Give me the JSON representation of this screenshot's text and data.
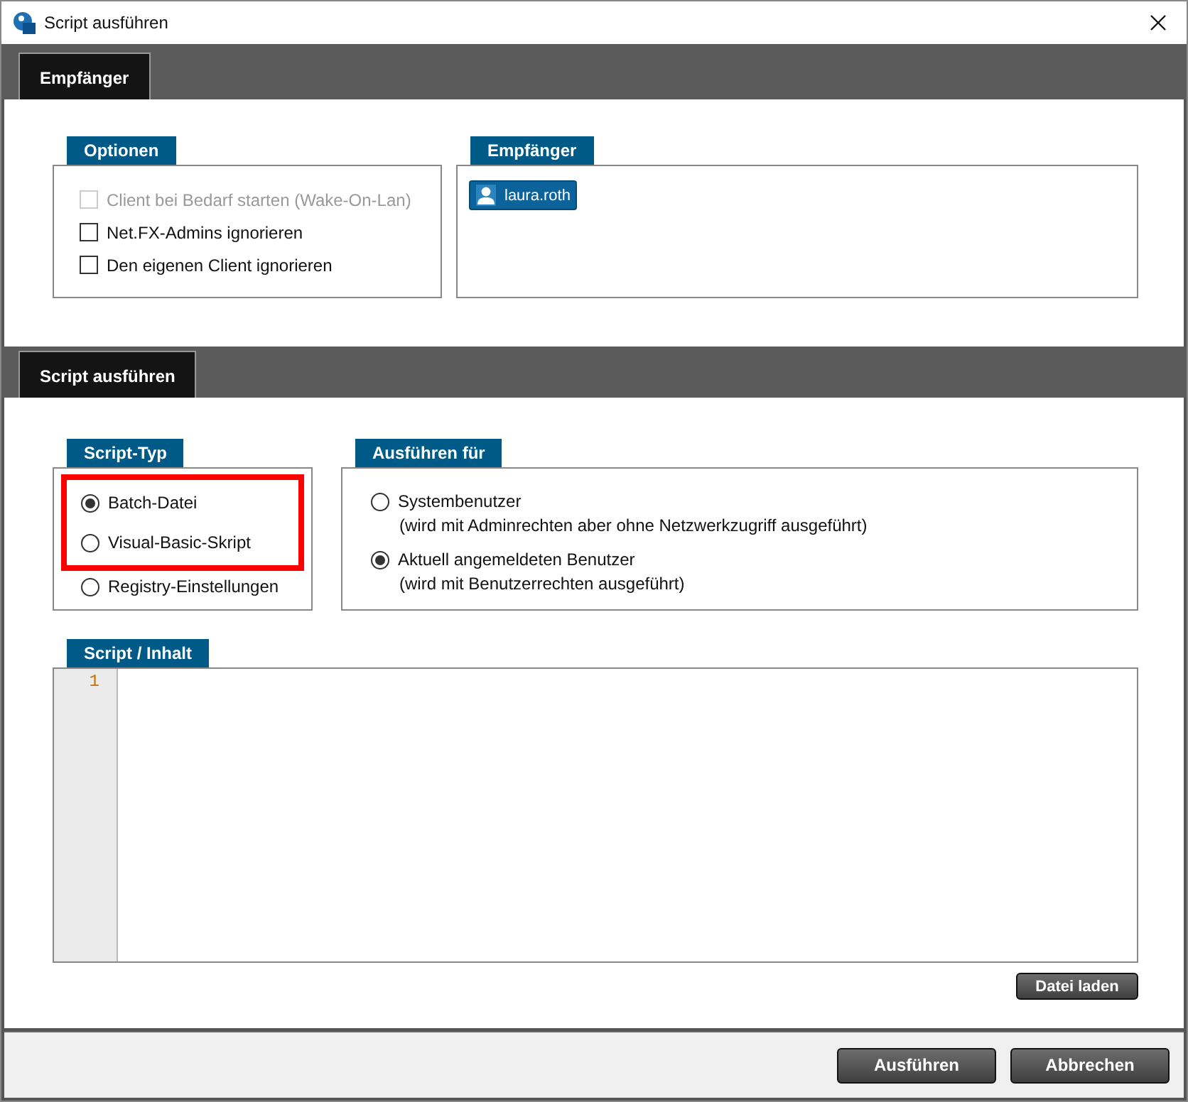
{
  "window": {
    "title": "Script ausführen"
  },
  "sections": [
    {
      "tab": "Empfänger"
    },
    {
      "tab": "Script ausführen"
    }
  ],
  "options": {
    "title": "Optionen",
    "items": [
      {
        "label": "Client bei Bedarf starten (Wake-On-Lan)",
        "checked": false,
        "disabled": true
      },
      {
        "label": "Net.FX-Admins ignorieren",
        "checked": false,
        "disabled": false
      },
      {
        "label": "Den eigenen Client ignorieren",
        "checked": false,
        "disabled": false
      }
    ]
  },
  "recipients": {
    "title": "Empfänger",
    "items": [
      "laura.roth"
    ]
  },
  "script_type": {
    "title": "Script-Typ",
    "items": [
      {
        "label": "Batch-Datei",
        "selected": true,
        "highlighted": true
      },
      {
        "label": "Visual-Basic-Skript",
        "selected": false,
        "highlighted": true
      },
      {
        "label": "Registry-Einstellungen",
        "selected": false,
        "highlighted": false
      }
    ]
  },
  "run_as": {
    "title": "Ausführen für",
    "items": [
      {
        "label": "Systembenutzer",
        "note": "(wird mit Adminrechten aber ohne Netzwerkzugriff ausgeführt)",
        "selected": false
      },
      {
        "label": "Aktuell angemeldeten Benutzer",
        "note": "(wird mit Benutzerrechten ausgeführt)",
        "selected": true
      }
    ]
  },
  "script": {
    "title": "Script / Inhalt",
    "line_numbers": [
      "1"
    ],
    "load_button": "Datei laden"
  },
  "buttons": [
    "Ausführen",
    "Abbrechen"
  ]
}
